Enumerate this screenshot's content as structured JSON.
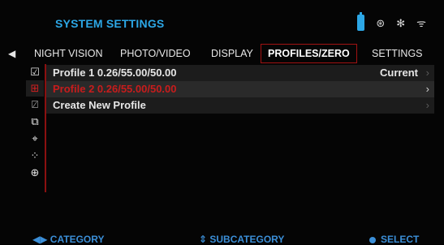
{
  "header": {
    "title": "SYSTEM SETTINGS",
    "accent_color": "#2ca7e6",
    "status_icons": [
      {
        "name": "battery-icon"
      },
      {
        "name": "wifi-connected-icon",
        "glyph": "⊛"
      },
      {
        "name": "bluetooth-icon",
        "glyph": "✻"
      },
      {
        "name": "wifi-icon",
        "glyph": "ᯤ"
      }
    ]
  },
  "tabs": [
    {
      "label": "NIGHT VISION"
    },
    {
      "label": "PHOTO/VIDEO"
    },
    {
      "label": "DISPLAY"
    },
    {
      "label": "PROFILES/ZERO",
      "active": true
    },
    {
      "label": "SETTINGS"
    }
  ],
  "back_icon": "back-arrow-icon",
  "rail": [
    {
      "name": "checkbox-icon",
      "glyph": "☑"
    },
    {
      "name": "delete-profile-icon",
      "glyph": "⊞",
      "selected": true
    },
    {
      "name": "create-profile-icon",
      "glyph": "⍁"
    },
    {
      "name": "edit-profile-icon",
      "glyph": "⧉"
    },
    {
      "name": "crosshair-zero-icon",
      "glyph": "⌖"
    },
    {
      "name": "multi-dot-icon",
      "glyph": "⁘"
    },
    {
      "name": "reticle-icon",
      "glyph": "⊕"
    }
  ],
  "profiles": [
    {
      "label": "Profile 1 0.26/55.00/50.00",
      "right": "Current",
      "chev": "›"
    },
    {
      "label": "Profile 2 0.26/55.00/50.00",
      "right": "",
      "chev": "›",
      "selected": true
    },
    {
      "label": "Create New Profile",
      "right": "",
      "chev": "›"
    }
  ],
  "footer": {
    "category": "CATEGORY",
    "subcategory": "SUBCATEGORY",
    "select": "SELECT",
    "color": "#3b8fd8"
  }
}
